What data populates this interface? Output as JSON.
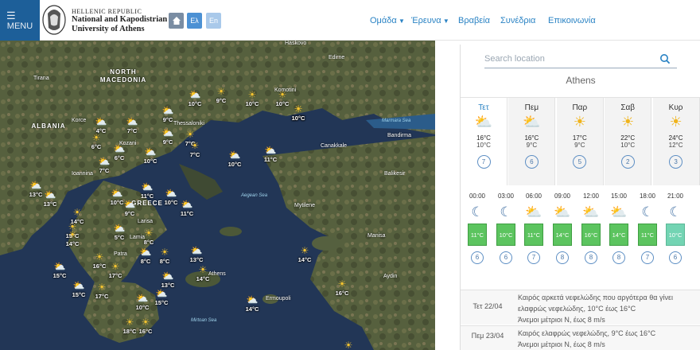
{
  "header": {
    "menu_label": "MENU",
    "uni_line1": "HELLENIC REPUBLIC",
    "uni_line2": "National and Kapodistrian",
    "uni_line3": "University of Athens",
    "lang_el": "Ελ",
    "lang_en": "En",
    "nav": [
      {
        "label": "Ομάδα",
        "has_dropdown": true
      },
      {
        "label": "Έρευνα",
        "has_dropdown": true
      },
      {
        "label": "Βραβεία",
        "has_dropdown": false
      },
      {
        "label": "Συνέδρια",
        "has_dropdown": false
      },
      {
        "label": "Επικοινωνία",
        "has_dropdown": false
      }
    ]
  },
  "map": {
    "countries": [
      "NORTH MACEDONIA",
      "ALBANIA",
      "GREECE"
    ],
    "cities": [
      "Haskovo",
      "Edirne",
      "Tirana",
      "Komotini",
      "Korce",
      "Thessaloniki",
      "Kozani",
      "Canakkale",
      "Bandirma",
      "Balikesir",
      "Ioannina",
      "Larisa",
      "Lamia",
      "Mytilene",
      "Manisa",
      "Patra",
      "Aydin",
      "Athens",
      "Ermoupoli"
    ],
    "seas": [
      "Marmara Sea",
      "Aegean Sea",
      "Mirtoan Sea"
    ],
    "markers": [
      {
        "icon": "cloudy",
        "temp": "10°C"
      },
      {
        "icon": "sun",
        "temp": "9°C"
      },
      {
        "icon": "sun",
        "temp": "10°C"
      },
      {
        "icon": "sun",
        "temp": "10°C"
      },
      {
        "icon": "sun",
        "temp": "10°C"
      },
      {
        "icon": "cloudy",
        "temp": "4°C"
      },
      {
        "icon": "cloudy",
        "temp": "7°C"
      },
      {
        "icon": "cloudy",
        "temp": "9°C"
      },
      {
        "icon": "sun",
        "temp": "6°C"
      },
      {
        "icon": "sun",
        "temp": "7°C"
      },
      {
        "icon": "cloudy",
        "temp": "9°C"
      },
      {
        "icon": "cloudy",
        "temp": "6°C"
      },
      {
        "icon": "cloudy",
        "temp": "7°C"
      },
      {
        "icon": "cloudy",
        "temp": "10°C"
      },
      {
        "icon": "sun",
        "temp": "7°C"
      },
      {
        "icon": "cloudy",
        "temp": "10°C"
      },
      {
        "icon": "cloudy",
        "temp": "11°C"
      },
      {
        "icon": "sun",
        "temp": "10°C"
      },
      {
        "icon": "cloudy",
        "temp": "13°C"
      },
      {
        "icon": "cloudy",
        "temp": "13°C"
      },
      {
        "icon": "cloudy",
        "temp": "11°C"
      },
      {
        "icon": "cloudy",
        "temp": "10°C"
      },
      {
        "icon": "cloudy",
        "temp": "9°C"
      },
      {
        "icon": "cloudy",
        "temp": "10°C"
      },
      {
        "icon": "cloudy",
        "temp": "11°C"
      },
      {
        "icon": "sun",
        "temp": "14°C"
      },
      {
        "icon": "sun",
        "temp": "15°C"
      },
      {
        "icon": "sun",
        "temp": "14°C"
      },
      {
        "icon": "cloudy",
        "temp": "5°C"
      },
      {
        "icon": "sun",
        "temp": "8°C"
      },
      {
        "icon": "sun",
        "temp": "16°C"
      },
      {
        "icon": "sun",
        "temp": "17°C"
      },
      {
        "icon": "cloudy",
        "temp": "8°C"
      },
      {
        "icon": "sun",
        "temp": "8°C"
      },
      {
        "icon": "cloudy",
        "temp": "13°C"
      },
      {
        "icon": "cloudy",
        "temp": "13°C"
      },
      {
        "icon": "sun",
        "temp": "14°C"
      },
      {
        "icon": "sun",
        "temp": "14°C"
      },
      {
        "icon": "cloudy",
        "temp": "15°C"
      },
      {
        "icon": "cloudy",
        "temp": "15°C"
      },
      {
        "icon": "sun",
        "temp": "17°C"
      },
      {
        "icon": "cloudy",
        "temp": "10°C"
      },
      {
        "icon": "cloudy",
        "temp": "15°C"
      },
      {
        "icon": "cloudy",
        "temp": "14°C"
      },
      {
        "icon": "sun",
        "temp": "16°C"
      },
      {
        "icon": "sun",
        "temp": "18°C"
      },
      {
        "icon": "sun",
        "temp": "16°C"
      },
      {
        "icon": "sun",
        "temp": "20°C"
      }
    ]
  },
  "search": {
    "placeholder": "Search location"
  },
  "location": "Athens",
  "days": [
    {
      "name": "Τετ",
      "hi": "16°C",
      "lo": "10°C",
      "wind": "7",
      "active": true
    },
    {
      "name": "Πεμ",
      "hi": "16°C",
      "lo": "9°C",
      "wind": "6",
      "active": false
    },
    {
      "name": "Παρ",
      "hi": "17°C",
      "lo": "9°C",
      "wind": "5",
      "active": false
    },
    {
      "name": "Σαβ",
      "hi": "22°C",
      "lo": "10°C",
      "wind": "2",
      "active": false
    },
    {
      "name": "Κυρ",
      "hi": "24°C",
      "lo": "12°C",
      "wind": "3",
      "active": false
    }
  ],
  "hours": [
    {
      "time": "00:00",
      "icon": "moon",
      "temp": "11°C",
      "wind": "6"
    },
    {
      "time": "03:00",
      "icon": "moon",
      "temp": "10°C",
      "wind": "6"
    },
    {
      "time": "06:00",
      "icon": "sun",
      "temp": "11°C",
      "wind": "7"
    },
    {
      "time": "09:00",
      "icon": "sun",
      "temp": "14°C",
      "wind": "8"
    },
    {
      "time": "12:00",
      "icon": "sun",
      "temp": "16°C",
      "wind": "8"
    },
    {
      "time": "15:00",
      "icon": "sun",
      "temp": "14°C",
      "wind": "8"
    },
    {
      "time": "18:00",
      "icon": "moon",
      "temp": "11°C",
      "wind": "7"
    },
    {
      "time": "21:00",
      "icon": "moon",
      "temp": "10°C",
      "wind": "6"
    }
  ],
  "descriptions": [
    {
      "date": "Τετ 22/04",
      "text": "Καιρός αρκετά νεφελώδης που αργότερα θα γίνει ελαφρώς νεφελώδης, 10°C έως 16°C",
      "wind": "Άνεμοι μέτριοι Ν, έως 8 m/s"
    },
    {
      "date": "Πεμ 23/04",
      "text": "Καιρός ελαφρώς νεφελώδης, 9°C έως 16°C",
      "wind": "Άνεμοι μέτριοι Ν, έως 8 m/s"
    }
  ],
  "colors": {
    "accent": "#2a83c4",
    "menu": "#1d5f99",
    "temp_warm": "#5cc45f",
    "temp_cool": "#73d4b3"
  }
}
